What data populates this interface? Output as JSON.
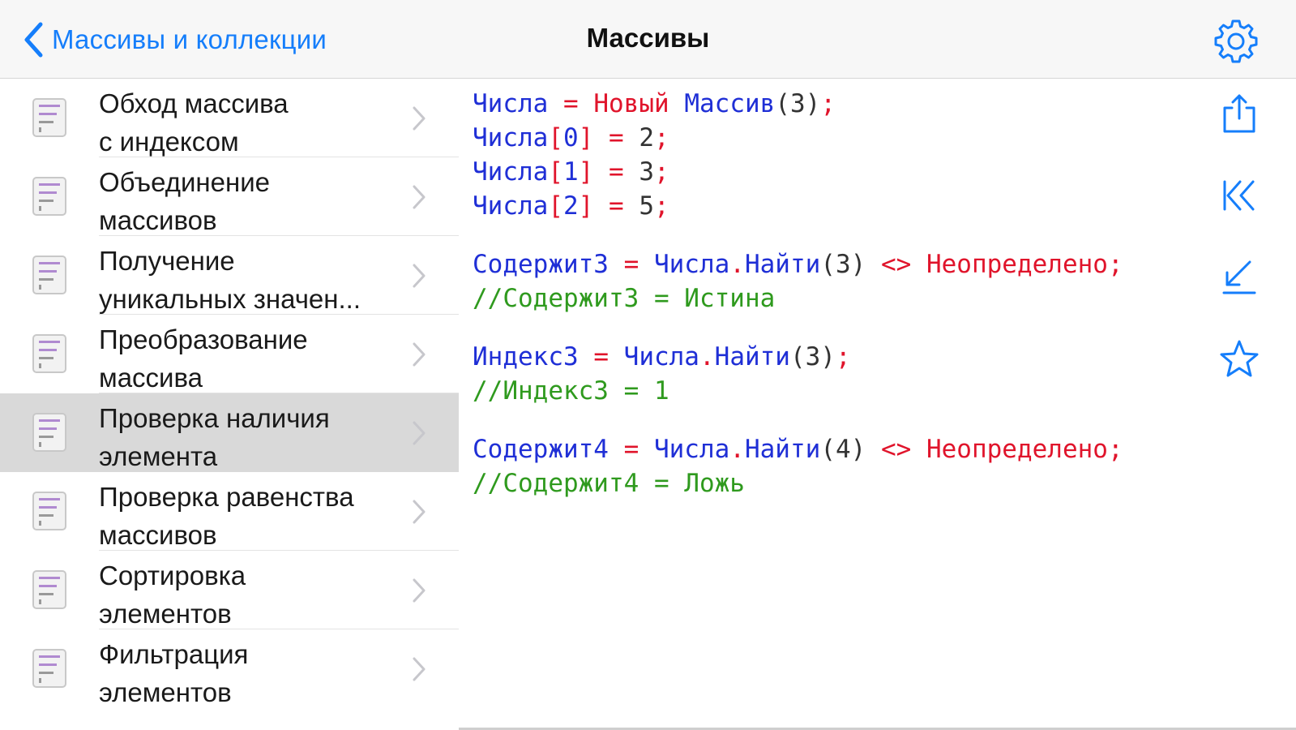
{
  "nav": {
    "back_label": "Массивы и коллекции",
    "title": "Массивы",
    "accent": "#157efb"
  },
  "list": {
    "items": [
      {
        "line1": "Обход массива",
        "line2": "с индексом"
      },
      {
        "line1": "Объединение",
        "line2": "массивов"
      },
      {
        "line1": "Получение",
        "line2": "уникальных значен..."
      },
      {
        "line1": "Преобразование",
        "line2": "массива"
      },
      {
        "line1": "Проверка наличия",
        "line2": "элемента",
        "selected": true
      },
      {
        "line1": "Проверка равенства",
        "line2": "массивов"
      },
      {
        "line1": "Сортировка",
        "line2": "элементов"
      },
      {
        "line1": "Фильтрация",
        "line2": "элементов"
      }
    ],
    "icon": "code-file-icon"
  },
  "code": {
    "l1": {
      "a": "Числа",
      "b": " = ",
      "c": "Новый",
      "d": " ",
      "e": "Массив",
      "f": "(3)",
      "g": ";"
    },
    "l2": {
      "a": "Числа",
      "b": "[",
      "c": "0",
      "d": "]",
      "e": " = ",
      "f": "2",
      "g": ";"
    },
    "l3": {
      "a": "Числа",
      "b": "[",
      "c": "1",
      "d": "]",
      "e": " = ",
      "f": "3",
      "g": ";"
    },
    "l4": {
      "a": "Числа",
      "b": "[",
      "c": "2",
      "d": "]",
      "e": " = ",
      "f": "5",
      "g": ";"
    },
    "l5": {
      "a": "Содержит3",
      "b": " = ",
      "c": "Числа",
      "d": ".",
      "e": "Найти",
      "f": "(3)",
      "g": " <> ",
      "h": "Неопределено",
      "i": ";"
    },
    "l6": {
      "a": "//Содержит3 = Истина"
    },
    "l7": {
      "a": "Индекс3",
      "b": " = ",
      "c": "Числа",
      "d": ".",
      "e": "Найти",
      "f": "(3)",
      "g": ";"
    },
    "l8": {
      "a": "//Индекс3 = 1"
    },
    "l9": {
      "a": "Содержит4",
      "b": " = ",
      "c": "Числа",
      "d": ".",
      "e": "Найти",
      "f": "(4)",
      "g": " <> ",
      "h": "Неопределено",
      "i": ";"
    },
    "l10": {
      "a": "//Содержит4 = Ложь"
    },
    "colors": {
      "identifier": "#1f2fd6",
      "operator": "#e0142b",
      "comment": "#2f9a1e",
      "number": "#333333"
    }
  },
  "toolbar": {
    "icons": [
      "share-icon",
      "first-icon",
      "sum-icon",
      "star-icon"
    ]
  }
}
